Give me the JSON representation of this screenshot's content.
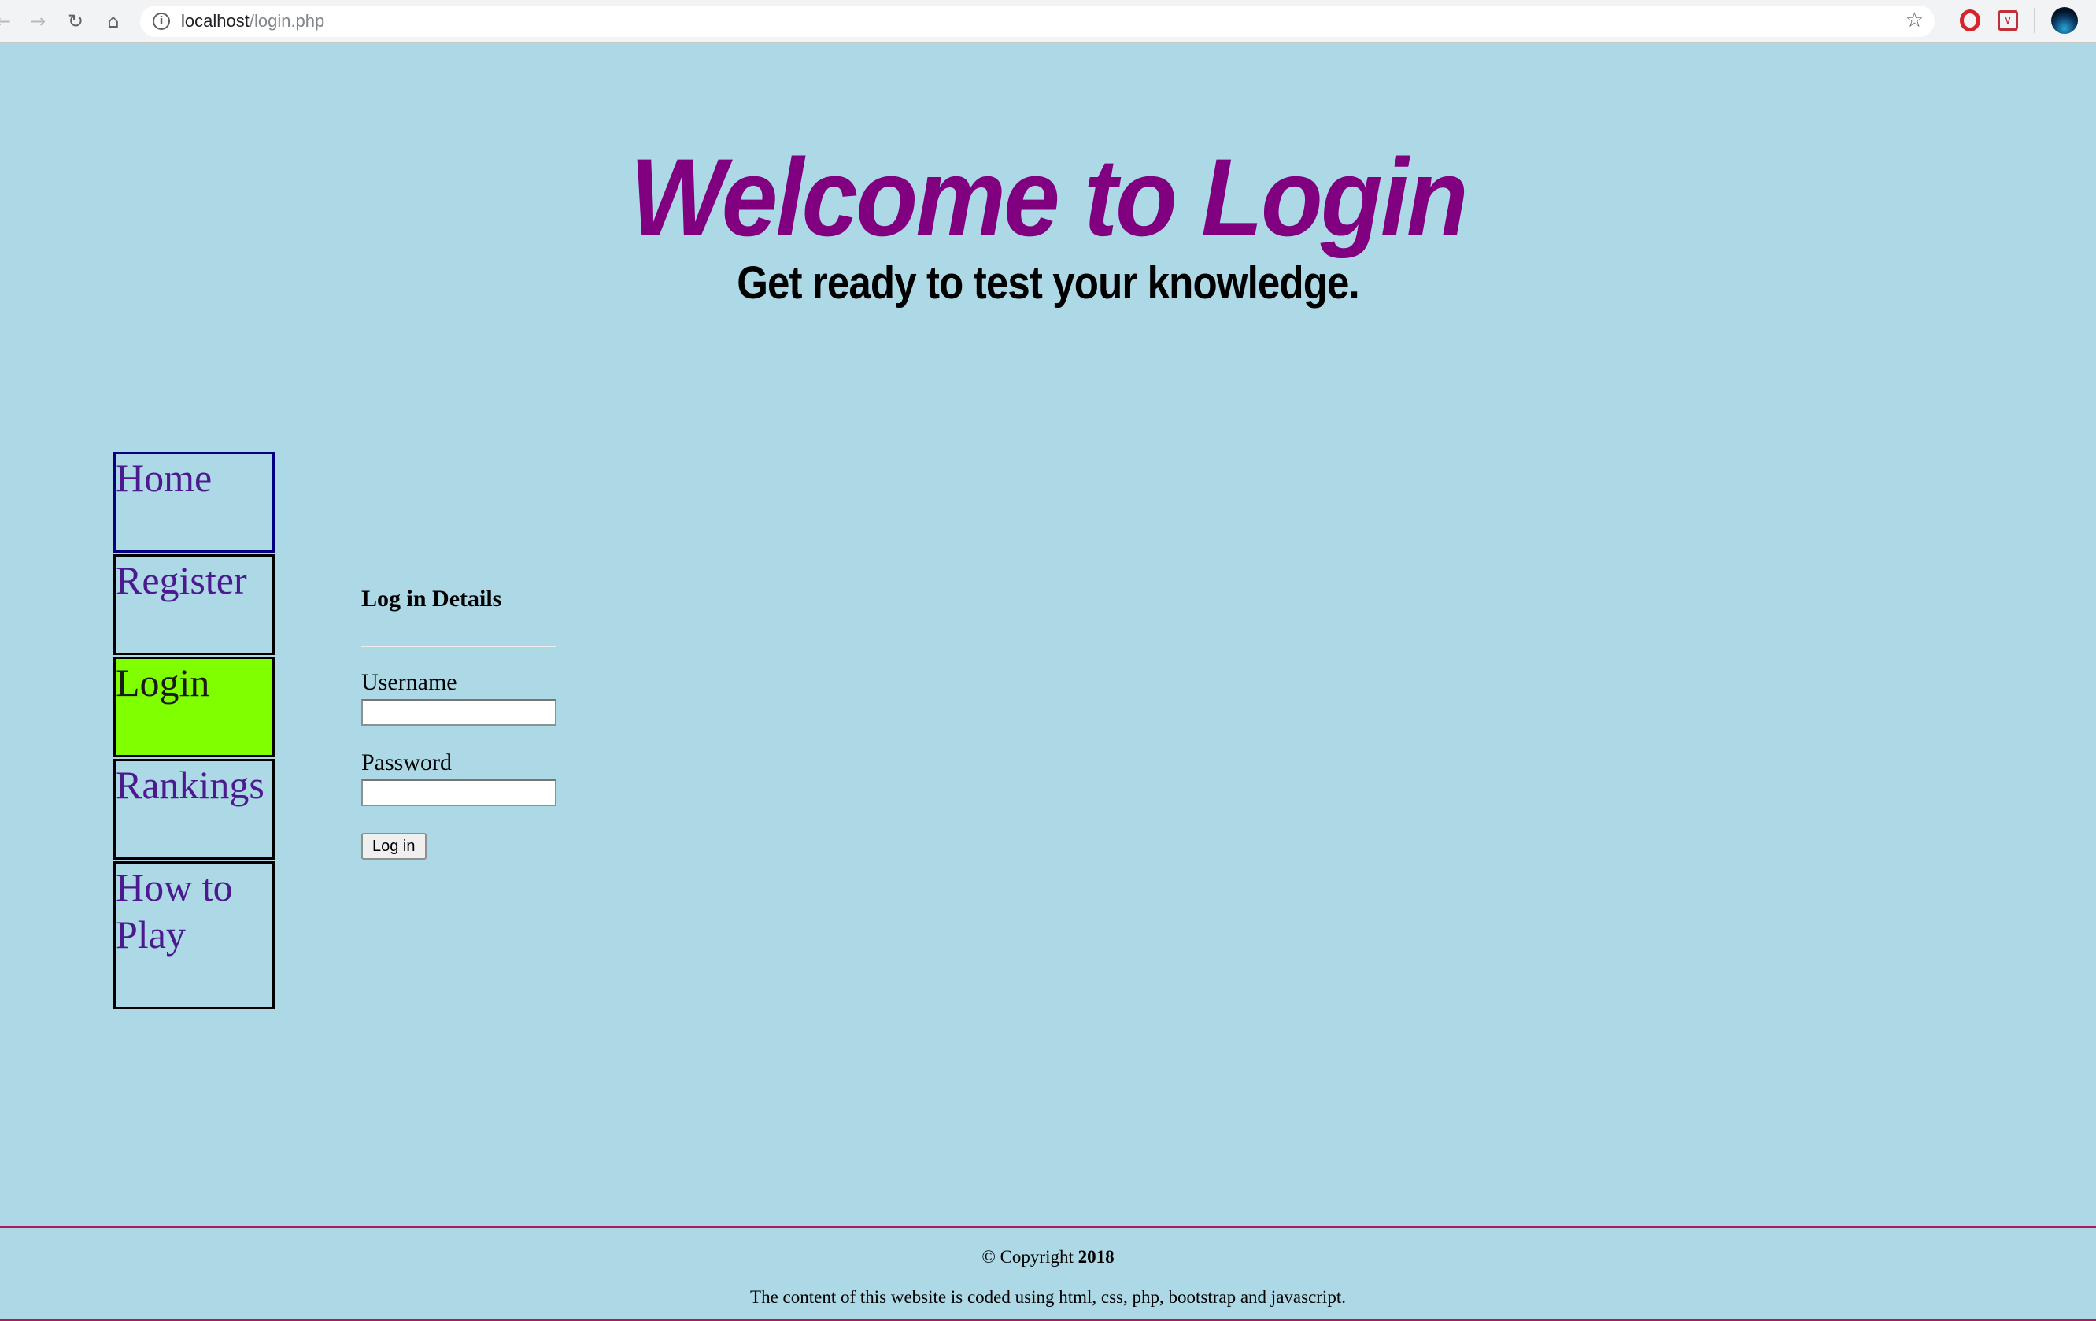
{
  "browser": {
    "back_icon": "back-arrow-icon",
    "forward_icon": "forward-arrow-icon",
    "reload_icon": "reload-icon",
    "home_icon": "home-icon",
    "url_host": "localhost",
    "url_path": "/login.php"
  },
  "header": {
    "title": "Welcome to Login",
    "subtitle": "Get ready to test your knowledge."
  },
  "nav": {
    "items": [
      {
        "label": "Home"
      },
      {
        "label": "Register"
      },
      {
        "label": "Login",
        "active": true
      },
      {
        "label": "Rankings"
      },
      {
        "label": "How to Play"
      }
    ]
  },
  "login_form": {
    "heading": "Log in Details",
    "username_label": "Username",
    "username_value": "",
    "password_label": "Password",
    "password_value": "",
    "submit_label": "Log in"
  },
  "footer": {
    "copyright_prefix": "© Copyright",
    "copyright_year": "2018",
    "note": "The content of this website is coded using html, css, php, bootstrap and javascript."
  },
  "colors": {
    "page_background": "#ADD8E6",
    "title": "#800080",
    "nav_text": "#4B1A8F",
    "active_nav": "#7FFF00",
    "footer_rule": "#B0195A"
  }
}
